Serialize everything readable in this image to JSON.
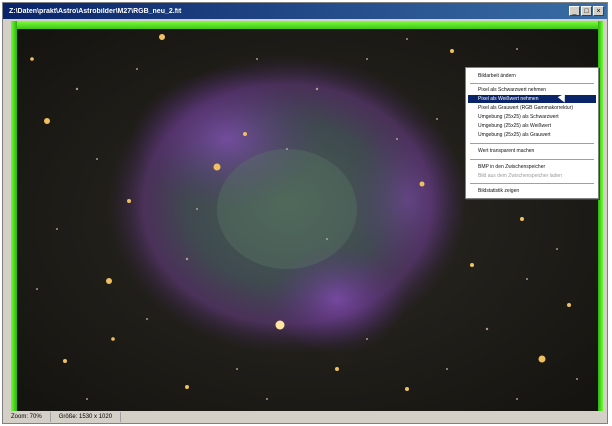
{
  "window": {
    "title": "Z:\\Daten\\prakt\\Astro\\Astrobilder\\M27\\RGB_neu_2.fit"
  },
  "context_menu": {
    "items": [
      {
        "label": "Bildarbeit ändern",
        "state": "normal"
      },
      {
        "label": "Pixel als Schwarzwert nehmen",
        "state": "normal"
      },
      {
        "label": "Pixel als Weißwert nehmen",
        "state": "highlighted"
      },
      {
        "label": "Pixel als Grauwert (RGB Gammakorrektur)",
        "state": "normal"
      },
      {
        "label": "Umgebung (25x25) als Schwarzwert",
        "state": "normal"
      },
      {
        "label": "Umgebung (25x25) als Weißwert",
        "state": "normal"
      },
      {
        "label": "Umgebung (25x25) als Grauwert",
        "state": "normal"
      },
      {
        "label": "Wert transparent machen",
        "state": "normal"
      },
      {
        "label": "BMP in den Zwischenspeicher",
        "state": "normal"
      },
      {
        "label": "Bild aus dem Zwischenspeicher laden",
        "state": "disabled"
      },
      {
        "label": "Bildstatistik zeigen",
        "state": "normal"
      }
    ]
  },
  "statusbar": {
    "zoom": "Zoom: 70%",
    "size": "Größe: 1530 x 1020"
  },
  "colors": {
    "border_green": "#4cd41e",
    "menu_highlight": "#0a246a"
  }
}
